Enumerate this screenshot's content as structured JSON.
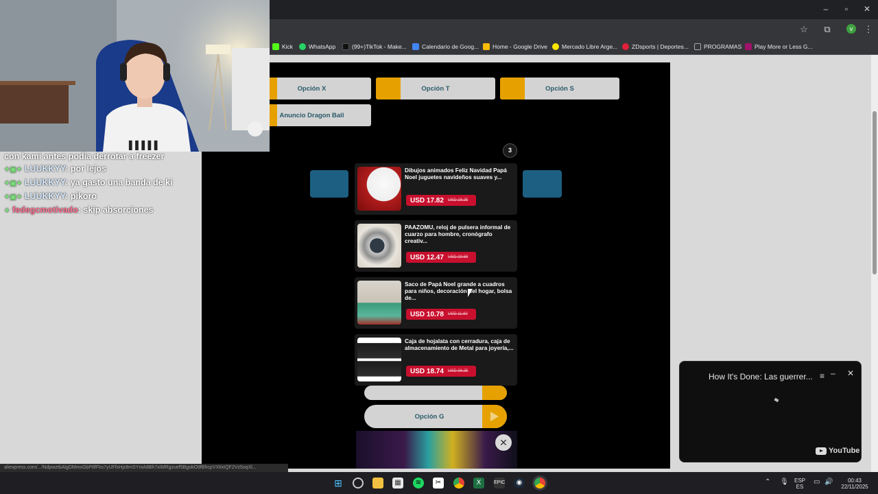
{
  "bookmarks": [
    {
      "label": "Kick",
      "color": "#53fc18"
    },
    {
      "label": "WhatsApp",
      "color": "#25d366"
    },
    {
      "label": "(99+)TikTok - Make...",
      "color": "#111111"
    },
    {
      "label": "Calendario de Goog...",
      "color": "#4285f4"
    },
    {
      "label": "Home - Google Drive",
      "color": "#fbbc04"
    },
    {
      "label": "Mercado Libre Arge...",
      "color": "#ffe600"
    },
    {
      "label": "ZDsports | Deportes...",
      "color": "#e0203a"
    },
    {
      "label": "PROGRAMAS",
      "color": "#888888"
    },
    {
      "label": "Play More or Less G...",
      "color": "#a0126a"
    }
  ],
  "page": {
    "options_top": [
      "Opción X",
      "Opción T",
      "Opción S"
    ],
    "option_dragon": "Anuncio Dragon Ball",
    "badge_count": "3",
    "option_g": "Opción G",
    "close_glyph": "✕"
  },
  "ads": [
    {
      "title": "Dibujos animados Feliz Navidad Papá Noel juguetes navideños suaves y...",
      "price": "USD 17.82",
      "old_price": "USD 28.25"
    },
    {
      "title": "PAAZOMU, reloj de pulsera informal de cuarzo para hombre, cronógrafo creativ...",
      "price": "USD 12.47",
      "old_price": "USD 29.69"
    },
    {
      "title": "Saco de Papá Noel grande a cuadros para niños, decoración del hogar, bolsa de...",
      "price": "USD 10.78",
      "old_price": "USD 11.80"
    },
    {
      "title": "Caja de hojalata con cerradura, caja de almacenamiento de Metal para joyería,...",
      "price": "USD 18.74",
      "old_price": "USD 38.25"
    }
  ],
  "chat": [
    {
      "user": "",
      "badges": "",
      "message": "con kami antes podia derrotar a freezer"
    },
    {
      "user": "LUUKKYY",
      "badges": "✦▣✦",
      "message": "por lejos"
    },
    {
      "user": "LUUKKYY",
      "badges": "✦▣✦",
      "message": "ya gasto una banda de ki"
    },
    {
      "user": "LUUKKYY",
      "badges": "✦▣✦",
      "message": "pikoro"
    },
    {
      "user": "fedegcmotivado",
      "badges": "✦",
      "message": "skip absorciones"
    }
  ],
  "youtube": {
    "title": "How It's Done: Las guerrer...",
    "logo": "YouTube"
  },
  "status_url": "aliexpress.com/.../NdpwztbAlgDMmxGbP8fFks7yUFfsHjz8mSYmA8Bh7xIMRgzuef5BgokO9fBhcpVXtlxtQF2Vz5oqXl...",
  "tray": {
    "lang": "ESP",
    "lang2": "ES",
    "time": "00:43",
    "date": "22/11/2025"
  }
}
